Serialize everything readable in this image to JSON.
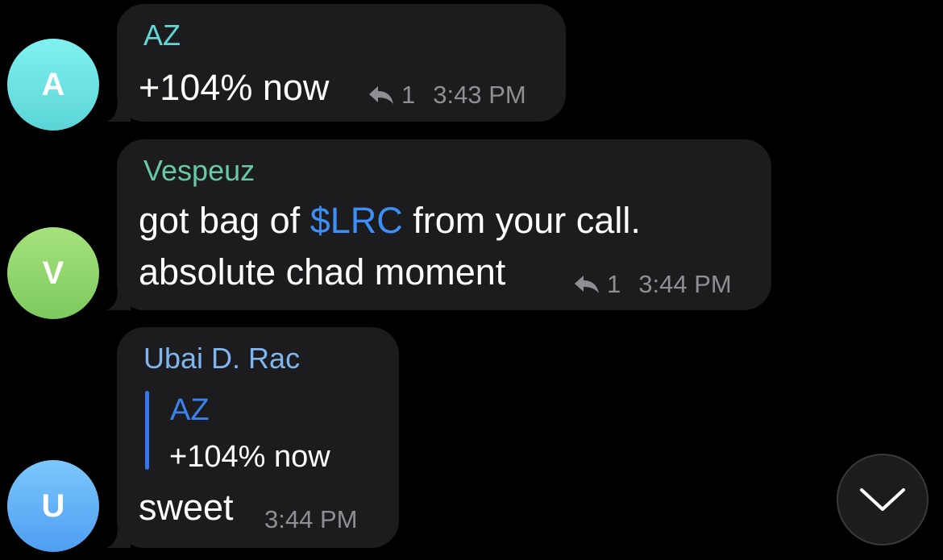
{
  "messages": [
    {
      "avatar_letter": "A",
      "sender": "AZ",
      "sender_color": "#62d5d7",
      "text": "+104% now",
      "reply_count": "1",
      "time": "3:43 PM"
    },
    {
      "avatar_letter": "V",
      "sender": "Vespeuz",
      "sender_color": "#67c9a3",
      "text_line1_before": "got bag of ",
      "text_line1_link": "$LRC",
      "text_line1_after": " from your call.",
      "text_line2": "absolute chad moment",
      "reply_count": "1",
      "time": "3:44 PM"
    },
    {
      "avatar_letter": "U",
      "sender": "Ubai D. Rac",
      "sender_color": "#7fb6f0",
      "quote": {
        "sender": "AZ",
        "text": "+104% now"
      },
      "text": "sweet",
      "time": "3:44 PM"
    }
  ],
  "icons": {
    "reply": "reply-arrow-icon",
    "scroll": "chevron-down-icon"
  },
  "colors": {
    "background": "#000000",
    "bubble": "#1c1c1e",
    "link": "#3d8ef7",
    "meta": "#8e8e93"
  }
}
